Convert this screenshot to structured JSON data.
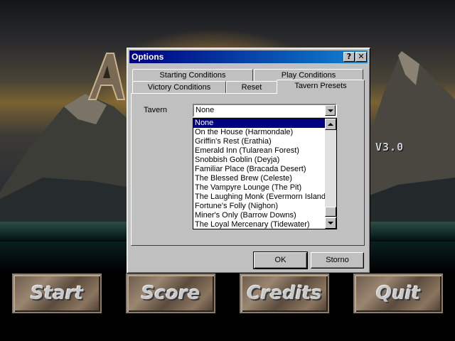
{
  "game": {
    "version": "V3.0",
    "menu": [
      "Start",
      "Score",
      "Credits",
      "Quit"
    ]
  },
  "dialog": {
    "title": "Options",
    "help_glyph": "?",
    "close_glyph": "✕",
    "tabs": [
      {
        "label": "Starting Conditions"
      },
      {
        "label": "Play Conditions"
      },
      {
        "label": "Victory Conditions"
      },
      {
        "label": "Reset"
      },
      {
        "label": "Tavern Presets"
      }
    ],
    "active_tab": "Tavern Presets",
    "tavern": {
      "label": "Tavern",
      "selected": "None",
      "options": [
        "None",
        "On the House (Harmondale)",
        "Griffin's Rest (Erathia)",
        "Emerald Inn (Tularean Forest)",
        "Snobbish Goblin (Deyja)",
        "Familiar Place (Bracada Desert)",
        "The Blessed Brew (Celeste)",
        "The Vampyre Lounge (The Pit)",
        "The Laughing Monk (Evermorn Island)",
        "Fortune's Folly (Nighon)",
        "Miner's Only (Barrow Downs)",
        "The Loyal Mercenary (Tidewater)"
      ]
    },
    "ok_label": "OK",
    "cancel_label": "Storno"
  },
  "colors": {
    "titlebar_start": "#000080",
    "titlebar_end": "#1084d0",
    "selection": "#000080",
    "face": "#c0c0c0"
  }
}
